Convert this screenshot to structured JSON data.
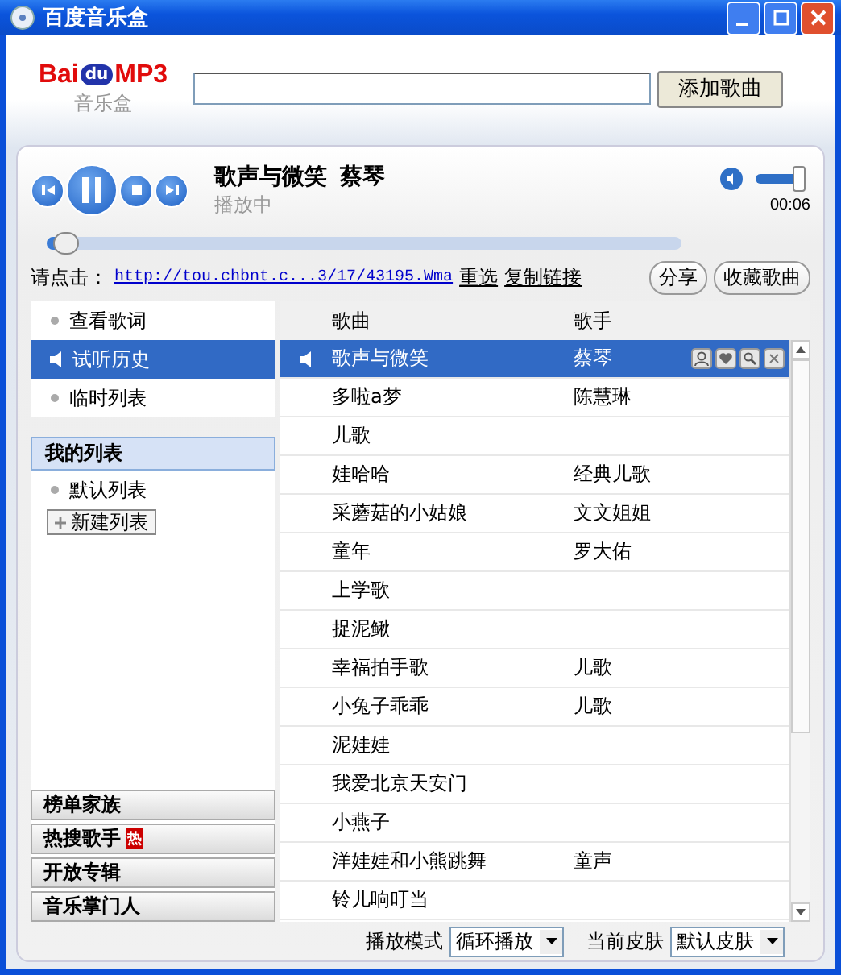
{
  "window": {
    "title": "百度音乐盒"
  },
  "logo": {
    "brand": "Bai",
    "badge": "du",
    "suffix": "MP3",
    "subtitle": "音乐盒"
  },
  "add_button": "添加歌曲",
  "player": {
    "playing": true,
    "song": "歌声与微笑",
    "artist": "蔡琴",
    "status": "播放中",
    "time": "00:06",
    "volume": {
      "level": 0.9
    },
    "progress": {
      "level": 0.03
    }
  },
  "link_row": {
    "label": "请点击：",
    "url": "http://tou.chbnt.c...3/17/43195.Wma",
    "links": [
      "重选",
      "复制链接"
    ],
    "buttons": [
      "分享",
      "收藏歌曲"
    ]
  },
  "sidebar": {
    "items": [
      {
        "label": "查看歌词",
        "selected": false
      },
      {
        "label": "试听历史",
        "selected": true
      },
      {
        "label": "临时列表",
        "selected": false
      }
    ],
    "my_lists": {
      "title": "我的列表",
      "items": [
        {
          "label": "默认列表",
          "selected": false
        }
      ],
      "new_button": "新建列表"
    },
    "categories": [
      {
        "label": "榜单家族"
      },
      {
        "label": "热搜歌手",
        "badge": "热"
      },
      {
        "label": "开放专辑"
      },
      {
        "label": "音乐掌门人"
      }
    ]
  },
  "table": {
    "columns": [
      "歌曲",
      "歌手"
    ],
    "rows": [
      {
        "song": "歌声与微笑",
        "artist": "蔡琴",
        "selected": true,
        "playing": true
      },
      {
        "song": "多啦a梦",
        "artist": "陈慧琳",
        "selected": false,
        "playing": false
      },
      {
        "song": "儿歌",
        "selected": false,
        "playing": false
      },
      {
        "song": "娃哈哈",
        "artist": "经典儿歌",
        "selected": false,
        "playing": false
      },
      {
        "song": "采蘑菇的小姑娘",
        "artist": "文文姐姐",
        "selected": false,
        "playing": false
      },
      {
        "song": "童年",
        "artist": "罗大佑",
        "selected": false,
        "playing": false
      },
      {
        "song": "上学歌",
        "selected": false,
        "playing": false
      },
      {
        "song": "捉泥鳅",
        "selected": false,
        "playing": false
      },
      {
        "song": "幸福拍手歌",
        "artist": "儿歌",
        "selected": false,
        "playing": false
      },
      {
        "song": "小兔子乖乖",
        "artist": "儿歌",
        "selected": false,
        "playing": false
      },
      {
        "song": "泥娃娃",
        "selected": false,
        "playing": false
      },
      {
        "song": "我爱北京天安门",
        "selected": false,
        "playing": false
      },
      {
        "song": "小燕子",
        "selected": false,
        "playing": false
      },
      {
        "song": "洋娃娃和小熊跳舞",
        "artist": "童声",
        "selected": false,
        "playing": false
      },
      {
        "song": "铃儿响叮当",
        "selected": false,
        "playing": false
      }
    ]
  },
  "footer": {
    "play_mode": {
      "label": "播放模式",
      "value": "循环播放"
    },
    "skin": {
      "label": "当前皮肤",
      "value": "默认皮肤"
    }
  }
}
